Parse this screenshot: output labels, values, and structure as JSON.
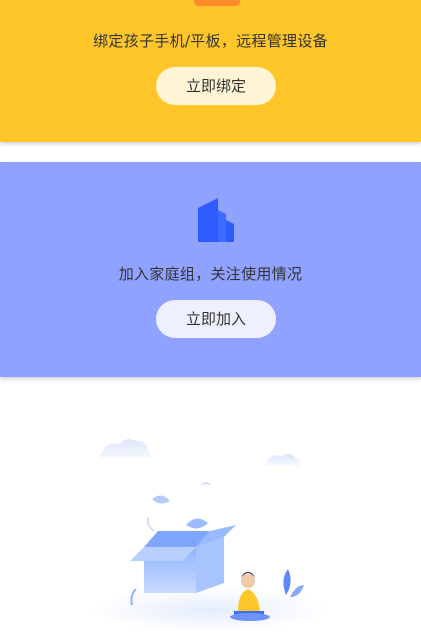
{
  "bind_card": {
    "description": "绑定孩子手机/平板，远程管理设备",
    "button_label": "立即绑定"
  },
  "join_card": {
    "description": "加入家庭组，关注使用情况",
    "button_label": "立即加入"
  },
  "colors": {
    "bind_card_bg": "#FFC62A",
    "join_card_bg": "#90A2FF",
    "building_icon": "#2F5CFF"
  },
  "icons": {
    "join_card_icon": "building-icon",
    "empty_state": "empty-box-illustration"
  }
}
